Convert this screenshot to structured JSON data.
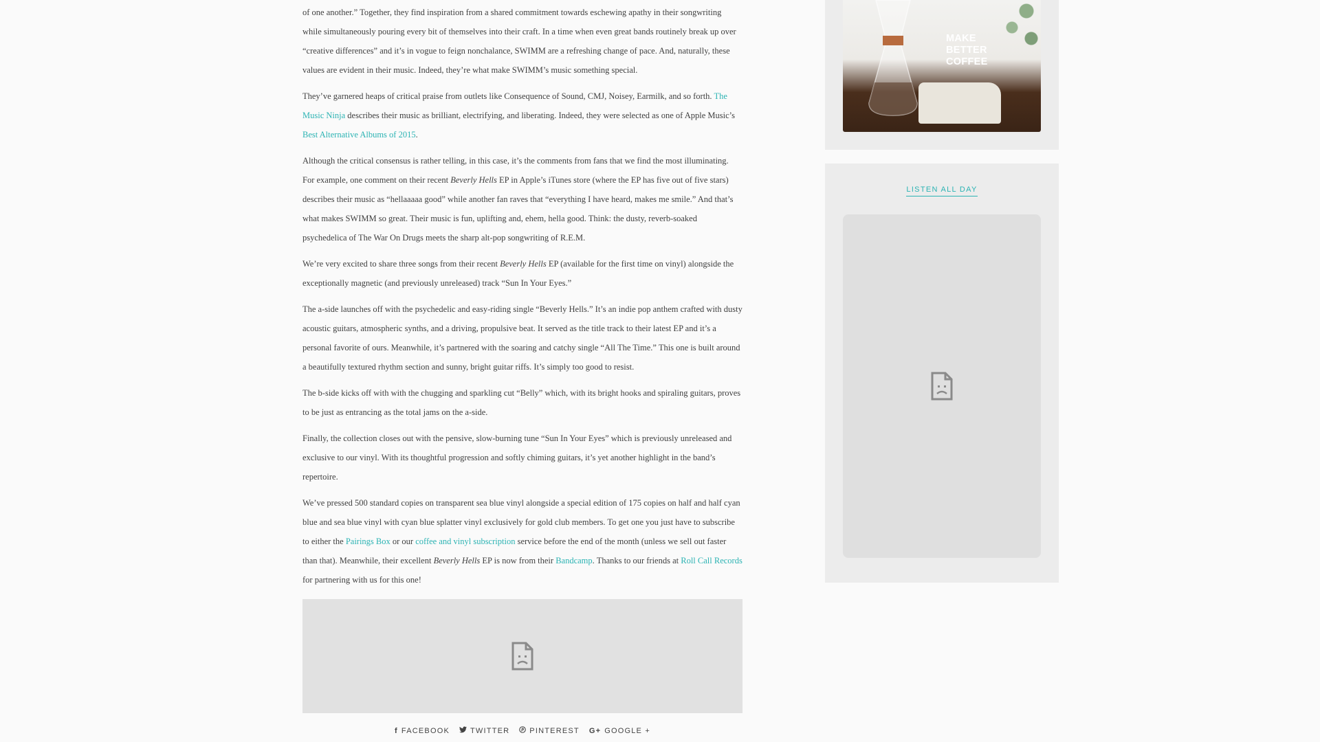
{
  "article": {
    "p1": {
      "text": "of one another.” Together, they find inspiration from a shared commitment towards eschewing apathy in their songwriting while simultaneously pouring every bit of themselves into their craft. In a time when even great bands routinely break up over “creative differences” and it’s in vogue to feign nonchalance, SWIMM are a refreshing change of pace. And, naturally, these values are evident in their music. Indeed, they’re what make SWIMM’s music something special."
    },
    "p2": {
      "a": "They’ve garnered heaps of critical praise from outlets like Consequence of Sound, CMJ, Noisey, Earmilk, and so forth. ",
      "link1": "The Music Ninja",
      "b": " describes their music as brilliant, electrifying, and liberating. Indeed, they were selected as one of Apple Music’s ",
      "link2": "Best Alternative Albums of 2015",
      "c": "."
    },
    "p3": {
      "a": "Although the critical consensus is rather telling, in this case, it’s the comments from fans that we find the most illuminating. For example, one comment on their recent ",
      "em": "Beverly Hells",
      "b": " EP in Apple’s iTunes store (where the EP has five out of five stars) describes their music as “hellaaaaa good” while another fan raves that “everything I have heard, makes me smile.” And that’s what makes SWIMM so great. Their music is fun, uplifting and, ehem, hella good. Think: the dusty, reverb-soaked psychedelica of The War On Drugs meets the sharp alt-pop songwriting of R.E.M."
    },
    "p4": {
      "a": "We’re very excited to share three songs from their recent ",
      "em": "Beverly Hells",
      "b": " EP (available for the first time on vinyl) alongside the exceptionally magnetic (and previously unreleased) track “Sun In Your Eyes.”"
    },
    "p5": {
      "text": "The a-side launches off with the psychedelic and easy-riding single “Beverly Hells.” It’s an indie pop anthem crafted with dusty acoustic guitars, atmospheric synths, and a driving, propulsive beat. It served as the title track to their latest EP and it’s a personal favorite of ours. Meanwhile, it’s partnered with the soaring and catchy single “All The Time.” This one is built around a beautifully textured rhythm section and sunny, bright guitar riffs. It’s simply too good to resist."
    },
    "p6": {
      "text": "The b-side kicks off with with the chugging and sparkling cut “Belly” which, with its bright hooks and spiraling guitars, proves to be just as entrancing as the total jams on the a-side."
    },
    "p7": {
      "text": "Finally, the collection closes out with the pensive, slow-burning tune “Sun In Your Eyes” which is previously unreleased and exclusive to our vinyl. With its thoughtful progression and softly chiming guitars, it’s yet another highlight in the band’s repertoire."
    },
    "p8": {
      "a": "We’ve pressed 500 standard copies on transparent sea blue vinyl alongside a special edition of 175 copies on half and half cyan blue and sea blue vinyl with cyan blue splatter vinyl exclusively for gold club members. To get one you just have to subscribe to either the ",
      "link1": "Pairings Box",
      "b": " or our ",
      "link2": "coffee and vinyl subscription",
      "c": " service before the end of the month (unless we sell out faster than that). Meanwhile, their excellent ",
      "em": "Beverly Hells",
      "d": " EP is now from their ",
      "link3": "Bandcamp",
      "e": ". Thanks to our friends at ",
      "link4": "Roll Call Records",
      "f": " for partnering with us for this one!"
    }
  },
  "share": {
    "facebook": {
      "icon": "facebook-icon",
      "glyph": "f",
      "label": "FACEBOOK"
    },
    "twitter": {
      "icon": "twitter-icon",
      "glyph": "🐦",
      "label": "TWITTER"
    },
    "pinterest": {
      "icon": "pinterest-icon",
      "glyph": "℗",
      "label": "PINTEREST"
    },
    "google": {
      "icon": "google-plus-icon",
      "glyph": "G+",
      "label": "GOOGLE +"
    }
  },
  "sidebar": {
    "ad": {
      "line1": "MAKE",
      "line2": "BETTER",
      "line3": "COFFEE"
    },
    "widget_title": "LISTEN ALL DAY"
  },
  "colors": {
    "link": "#2bb3b3",
    "sidebar_bg": "#ececec",
    "embed_bg": "#e1e1e1"
  }
}
